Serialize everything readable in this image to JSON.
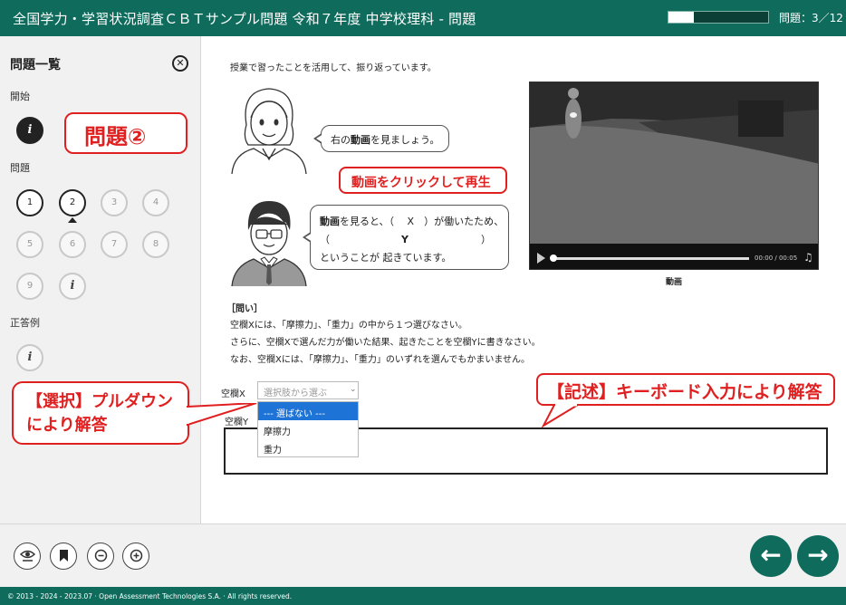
{
  "header": {
    "title": "全国学力・学習状況調査ＣＢＴサンプル問題 令和７年度 中学校理科 - 問題",
    "progress_fraction": 0.25,
    "question_counter": "問題：3／12"
  },
  "sidebar": {
    "title": "問題一覧",
    "close_glyph": "✕",
    "start_label": "開始",
    "questions_label": "問題",
    "answer_example_label": "正答例",
    "info_glyph": "i",
    "question_numbers": [
      "1",
      "2",
      "3",
      "4",
      "5",
      "6",
      "7",
      "8",
      "9"
    ],
    "current_question": "2"
  },
  "annotations": {
    "question_badge": "問題②",
    "select_note_line1": "【選択】プルダウン",
    "select_note_line2": "により解答",
    "video_note": "動画をクリックして再生",
    "keyboard_note": "【記述】キーボード入力により解答"
  },
  "content": {
    "intro": "授業で習ったことを活用して、振り返っています。",
    "speech1_pre": "右の",
    "speech1_bold": "動画",
    "speech1_post": "を見ましょう。",
    "speech2_bold": "動画",
    "speech2_line1_post": "を見ると、（　 X　）が働いたため、",
    "speech2_line2_open": "（",
    "speech2_line2_y": "Y",
    "speech2_line2_close": "）",
    "speech2_line3": "ということが 起きています。",
    "video_time": "00:00 / 00:05",
    "video_caption": "動画",
    "question_heading": "［問い］",
    "question_line1": "空欄Xには、「摩擦力」、「重力」の中から１つ選びなさい。",
    "question_line2": "さらに、空欄Xで選んだ力が働いた結果、起きたことを空欄Yに書きなさい。",
    "question_line3": "なお、空欄Xには、「摩擦力」、「重力」のいずれを選んでもかまいません。",
    "blank_x_label": "空欄X",
    "blank_y_label": "空欄Y",
    "select_placeholder": "選択肢から選ぶ",
    "dropdown_options": [
      "--- 選ばない ---",
      "摩擦力",
      "重力"
    ]
  },
  "toolbar": {
    "prev_glyph": "←",
    "next_glyph": "→"
  },
  "footer": {
    "text": "© 2013 - 2024 - 2023.07 · Open Assessment Technologies S.A. · All rights reserved."
  },
  "colors": {
    "brand": "#0f6b5c",
    "annotation_red": "#e02020",
    "dropdown_highlight": "#1e73d6"
  }
}
